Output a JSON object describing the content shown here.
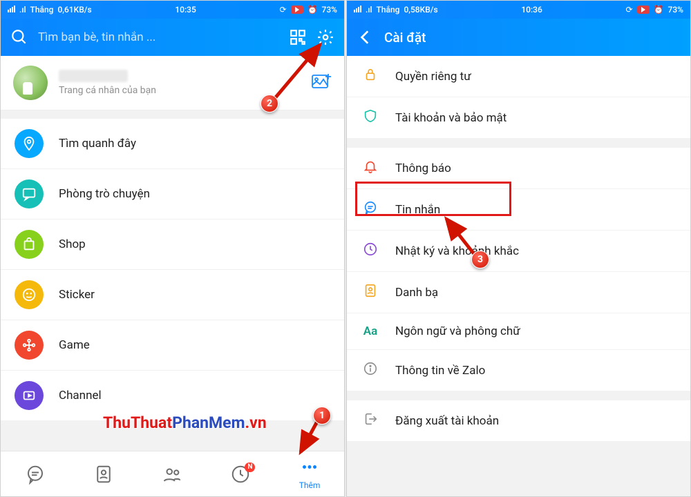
{
  "status": {
    "carrier": "Thắng",
    "net_left": "0,61KB/s",
    "time_left": "10:35",
    "battery_left": "73%",
    "net_right": "0,58KB/s",
    "time_right": "10:36",
    "battery_right": "73%",
    "signal_label": ".ıl",
    "alarm_icon": "alarm"
  },
  "left": {
    "search_placeholder": "Tìm bạn bè, tin nhắn ...",
    "profile_sub": "Trang cá nhân của bạn",
    "menu": [
      {
        "label": "Tìm quanh đây",
        "color": "#07A8FF"
      },
      {
        "label": "Phòng trò chuyện",
        "color": "#16C0B6"
      },
      {
        "label": "Shop",
        "color": "#87D01C"
      },
      {
        "label": "Sticker",
        "color": "#F5B90B"
      },
      {
        "label": "Game",
        "color": "#F1472E"
      },
      {
        "label": "Channel",
        "color": "#6B47DB"
      }
    ],
    "tabs": {
      "messages": "",
      "contacts": "",
      "groups": "",
      "timeline": "",
      "more": "Thêm",
      "timeline_badge": "N"
    },
    "watermark": {
      "part1": "ThuThuat",
      "part2": "PhanMem",
      "suffix": ".vn"
    }
  },
  "right": {
    "title": "Cài đặt",
    "groups": [
      [
        {
          "label": "Quyền riêng tư",
          "icon": "lock",
          "color": "#F5A623"
        },
        {
          "label": "Tài khoản và bảo mật",
          "icon": "shield",
          "color": "#18C1A8"
        }
      ],
      [
        {
          "label": "Thông báo",
          "icon": "bell",
          "color": "#F1472E"
        },
        {
          "label": "Tin nhắn",
          "icon": "chat",
          "color": "#1A8CFF"
        },
        {
          "label": "Nhật ký và khoảnh khắc",
          "icon": "clock",
          "color": "#8A4BD6"
        },
        {
          "label": "Danh bạ",
          "icon": "contacts",
          "color": "#F5A623"
        },
        {
          "label": "Ngôn ngữ và phông chữ",
          "icon": "aa",
          "color": "#16A085"
        },
        {
          "label": "Thông tin về Zalo",
          "icon": "info",
          "color": "#8f8f8f"
        }
      ],
      [
        {
          "label": "Đăng xuất tài khoản",
          "icon": "logout",
          "color": "#8f8f8f"
        }
      ]
    ]
  },
  "annotations": {
    "step1": "1",
    "step2": "2",
    "step3": "3"
  }
}
